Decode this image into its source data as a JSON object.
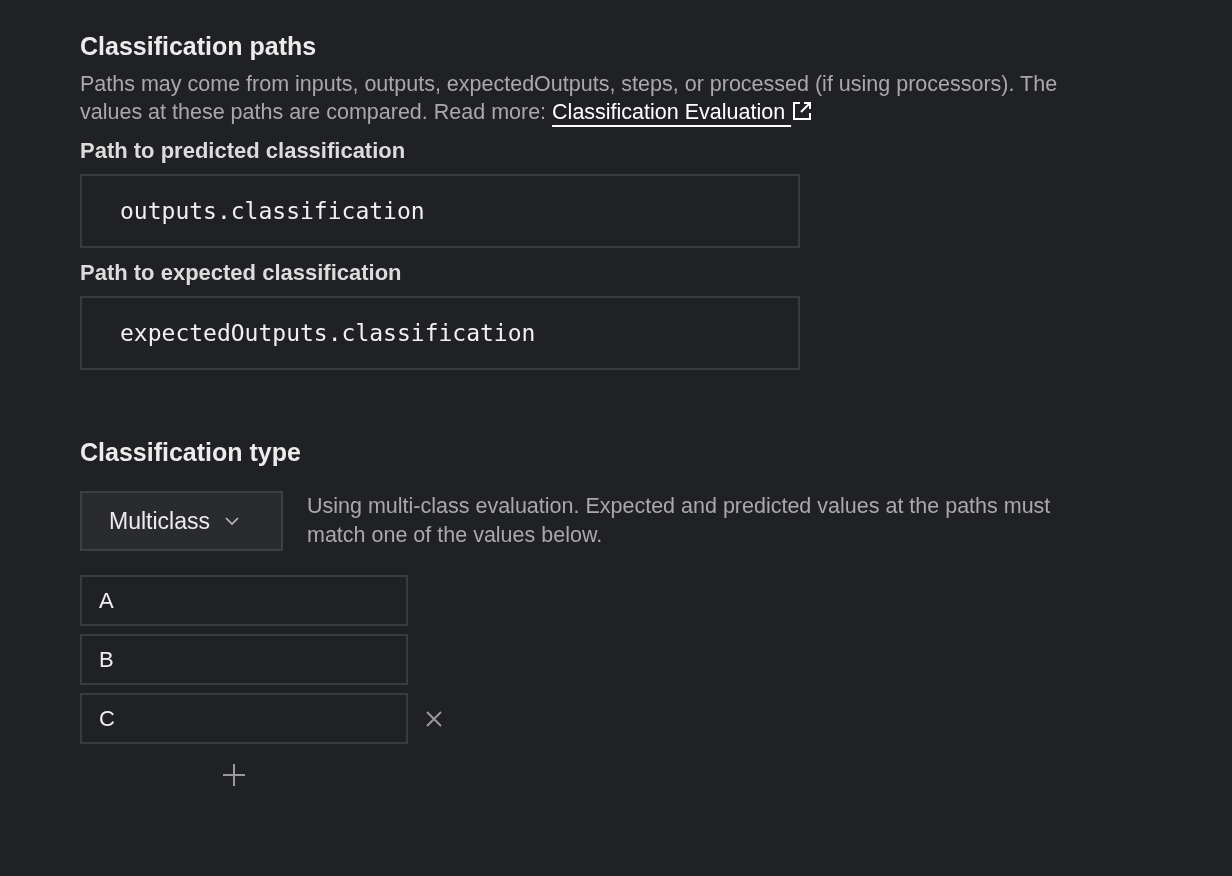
{
  "paths_section": {
    "title": "Classification paths",
    "description": "Paths may come from inputs, outputs, expectedOutputs, steps, or processed (if using processors). The values at these paths are compared. Read more: ",
    "link": "Classification Evaluation",
    "fields": [
      {
        "label": "Path to predicted classification",
        "value": "outputs.classification"
      },
      {
        "label": "Path to expected classification",
        "value": "expectedOutputs.classification"
      }
    ]
  },
  "type_section": {
    "title": "Classification type",
    "dropdown": "Multiclass",
    "description": "Using multi-class evaluation. Expected and predicted values at the paths must match one of the values below.",
    "values": [
      {
        "value": "A",
        "remove_visible": false
      },
      {
        "value": "B",
        "remove_visible": false
      },
      {
        "value": "C",
        "remove_visible": true
      }
    ]
  }
}
